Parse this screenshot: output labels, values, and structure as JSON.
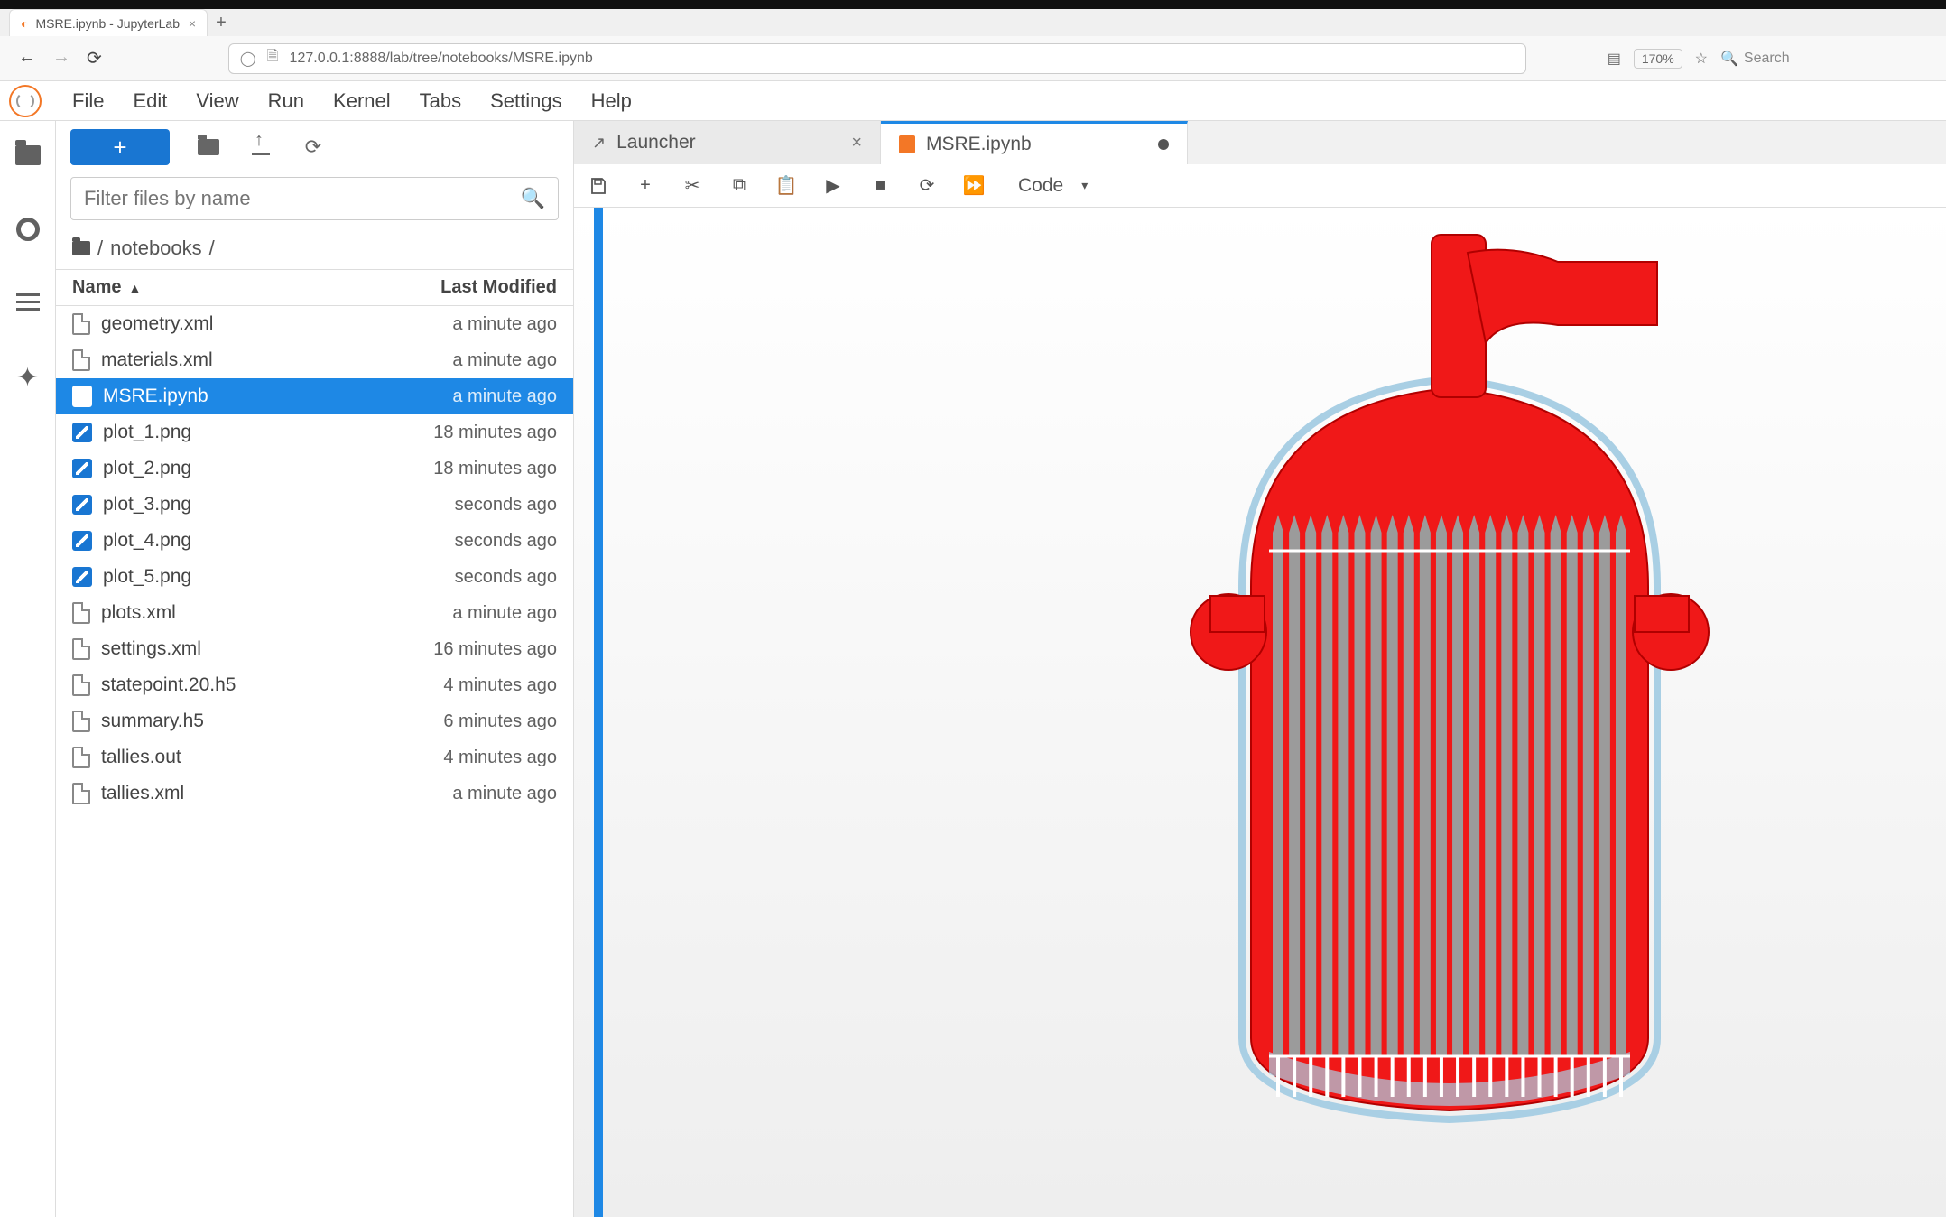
{
  "browser": {
    "tab_title": "MSRE.ipynb - JupyterLab",
    "url": "127.0.0.1:8888/lab/tree/notebooks/MSRE.ipynb",
    "zoom": "170%",
    "search_placeholder": "Search"
  },
  "menu": {
    "items": [
      "File",
      "Edit",
      "View",
      "Run",
      "Kernel",
      "Tabs",
      "Settings",
      "Help"
    ]
  },
  "sidebar": {
    "filter_placeholder": "Filter files by name",
    "breadcrumb_segments": [
      "/",
      "notebooks",
      "/"
    ],
    "columns": {
      "name": "Name",
      "modified": "Last Modified"
    },
    "files": [
      {
        "name": "geometry.xml",
        "modified": "a minute ago",
        "kind": "doc",
        "selected": false
      },
      {
        "name": "materials.xml",
        "modified": "a minute ago",
        "kind": "doc",
        "selected": false
      },
      {
        "name": "MSRE.ipynb",
        "modified": "a minute ago",
        "kind": "nb",
        "selected": true
      },
      {
        "name": "plot_1.png",
        "modified": "18 minutes ago",
        "kind": "img",
        "selected": false
      },
      {
        "name": "plot_2.png",
        "modified": "18 minutes ago",
        "kind": "img",
        "selected": false
      },
      {
        "name": "plot_3.png",
        "modified": "seconds ago",
        "kind": "img",
        "selected": false
      },
      {
        "name": "plot_4.png",
        "modified": "seconds ago",
        "kind": "img",
        "selected": false
      },
      {
        "name": "plot_5.png",
        "modified": "seconds ago",
        "kind": "img",
        "selected": false
      },
      {
        "name": "plots.xml",
        "modified": "a minute ago",
        "kind": "doc",
        "selected": false
      },
      {
        "name": "settings.xml",
        "modified": "16 minutes ago",
        "kind": "doc",
        "selected": false
      },
      {
        "name": "statepoint.20.h5",
        "modified": "4 minutes ago",
        "kind": "doc",
        "selected": false
      },
      {
        "name": "summary.h5",
        "modified": "6 minutes ago",
        "kind": "doc",
        "selected": false
      },
      {
        "name": "tallies.out",
        "modified": "4 minutes ago",
        "kind": "doc",
        "selected": false
      },
      {
        "name": "tallies.xml",
        "modified": "a minute ago",
        "kind": "doc",
        "selected": false
      }
    ]
  },
  "document_tabs": {
    "tabs": [
      {
        "label": "Launcher",
        "kind": "launcher",
        "active": false,
        "dirty": false,
        "closable": true
      },
      {
        "label": "MSRE.ipynb",
        "kind": "notebook",
        "active": true,
        "dirty": true,
        "closable": false
      }
    ]
  },
  "notebook_toolbar": {
    "cell_type": "Code"
  },
  "colors": {
    "accent": "#1e88e5",
    "jupyter_orange": "#f37726",
    "reactor_red": "#f01818",
    "reactor_gray": "#9b9b9b",
    "reactor_outline": "#a9cfe4"
  }
}
